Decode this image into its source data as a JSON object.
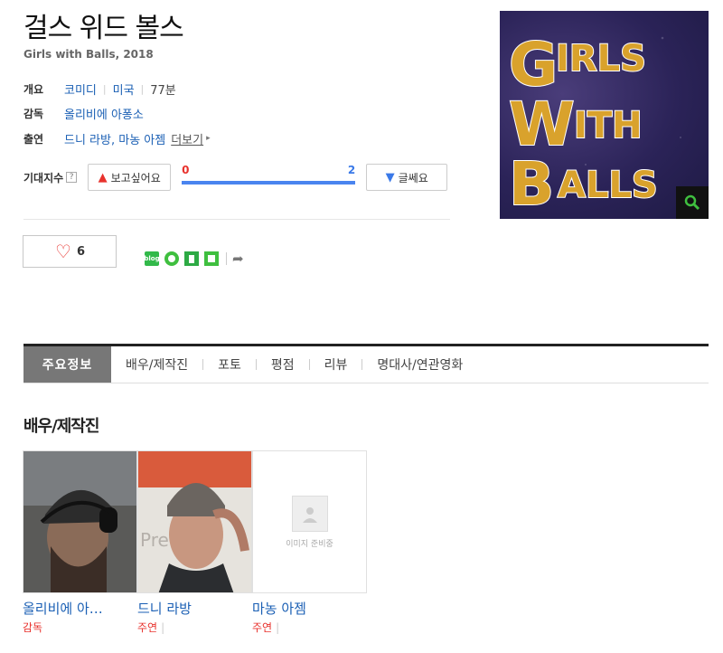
{
  "movie": {
    "title": "걸스 위드 볼스",
    "subtitle": "Girls with Balls, 2018"
  },
  "info": {
    "overview_label": "개요",
    "genre": "코미디",
    "country": "미국",
    "runtime": "77분",
    "director_label": "감독",
    "director": "올리비에 아퐁소",
    "cast_label": "출연",
    "cast": "드니 라방, 마농 아젬",
    "more": "더보기"
  },
  "expectation": {
    "label": "기대지수",
    "help": "?",
    "want_label": "보고싶어요",
    "not_label": "글쎄요",
    "want_count": "0",
    "not_count": "2",
    "not_fraction": 1.0
  },
  "like": {
    "count": "6"
  },
  "share": {
    "blog": "blog",
    "icons": [
      "blog-icon",
      "cafe-icon",
      "bookmark-icon",
      "memo-icon",
      "share-export-icon"
    ]
  },
  "poster": {
    "lines": [
      "GIRLS",
      "WITH",
      "BALLS"
    ],
    "accent": "#d9a22c",
    "bg": "#2b2358"
  },
  "tabs": [
    "주요정보",
    "배우/제작진",
    "포토",
    "평점",
    "리뷰",
    "명대사/연관영화"
  ],
  "cast_section": {
    "title": "배우/제작진",
    "members": [
      {
        "name": "올리비에 아…",
        "role": "감독"
      },
      {
        "name": "드니 라방",
        "role": "주연"
      },
      {
        "name": "마농 아젬",
        "role": "주연"
      }
    ],
    "placeholder_text": "이미지 준비중"
  },
  "colors": {
    "link": "#1a5fb4",
    "red": "#e8322d",
    "blue": "#4a84ef",
    "green": "#32b94a"
  }
}
